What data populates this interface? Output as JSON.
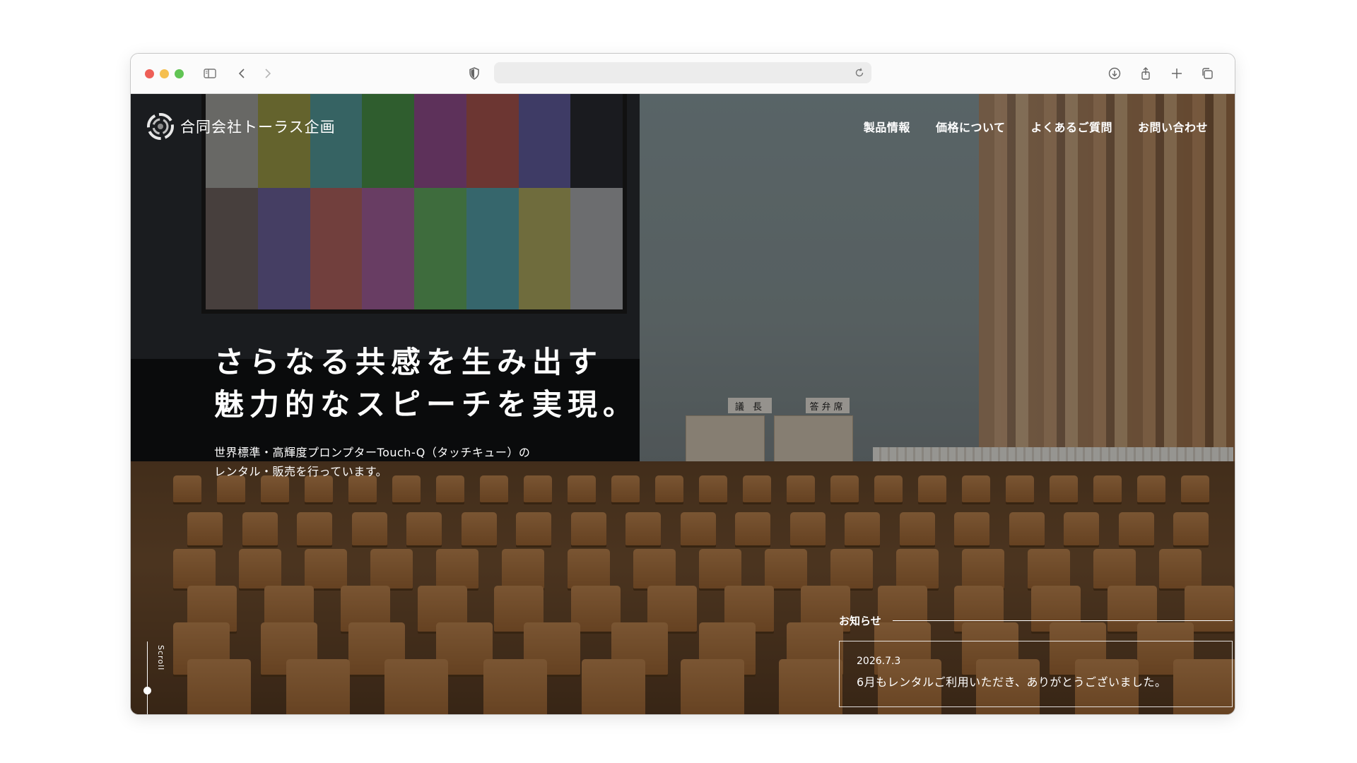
{
  "browser": {
    "traffic_lights": [
      "#ee5f57",
      "#f5bf4f",
      "#61c454"
    ],
    "icons": [
      "sidebar-icon",
      "back-icon",
      "forward-icon",
      "shield-icon",
      "reload-icon",
      "download-icon",
      "share-icon",
      "new-tab-icon",
      "tabs-overview-icon"
    ],
    "url": ""
  },
  "site": {
    "logo_text": "合同会社トーラス企画",
    "nav": [
      {
        "label": "製品情報"
      },
      {
        "label": "価格について"
      },
      {
        "label": "よくあるご質問"
      },
      {
        "label": "お問い合わせ"
      }
    ],
    "hero": {
      "title_line1": "さらなる共感を生み出す",
      "title_line2": "魅力的なスピーチを実現。",
      "sub_line1": "世界標準・高輝度プロンプターTouch-Q（タッチキュー）の",
      "sub_line2": "レンタル・販売を行っています。"
    },
    "scroll_label": "Scroll",
    "photo_signs": [
      "議 長",
      "答弁席"
    ],
    "news": {
      "heading": "お知らせ",
      "items": [
        {
          "date": "2026.7.3",
          "text": "6月もレンタルご利用いただき、ありがとうございました。"
        }
      ]
    }
  },
  "colors": {
    "screen_bars_top": [
      "#b9b9b3",
      "#b3b04d",
      "#5eb0b0",
      "#52a54e",
      "#a5559f",
      "#c25f57",
      "#6c68b3",
      "#2b2e32"
    ],
    "screen_bars_bottom": [
      "#7d706a",
      "#7a6cb0",
      "#c9706a",
      "#b96bb0",
      "#6cc06a",
      "#5fb6c0",
      "#c7c06a",
      "#c0c4c6"
    ]
  }
}
